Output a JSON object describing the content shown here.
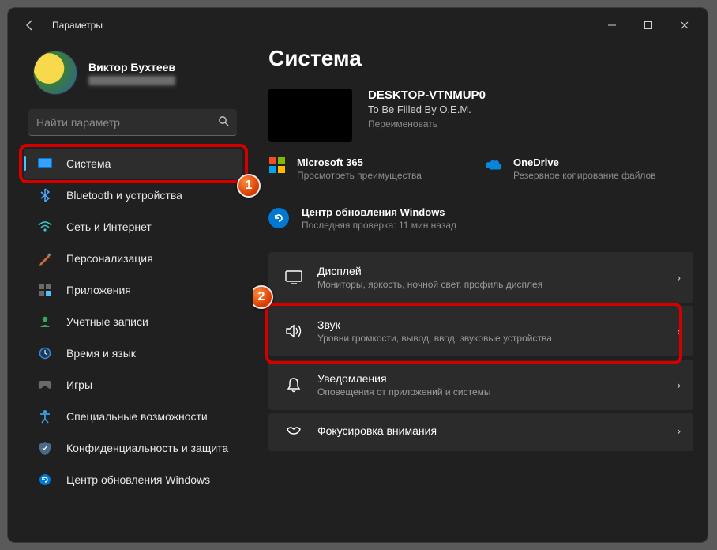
{
  "window": {
    "title": "Параметры"
  },
  "user": {
    "name": "Виктор Бухтеев"
  },
  "search": {
    "placeholder": "Найти параметр"
  },
  "sidebar": {
    "items": [
      {
        "label": "Система",
        "icon": "system"
      },
      {
        "label": "Bluetooth и устройства",
        "icon": "bluetooth"
      },
      {
        "label": "Сеть и Интернет",
        "icon": "network"
      },
      {
        "label": "Персонализация",
        "icon": "personalization"
      },
      {
        "label": "Приложения",
        "icon": "apps"
      },
      {
        "label": "Учетные записи",
        "icon": "accounts"
      },
      {
        "label": "Время и язык",
        "icon": "time"
      },
      {
        "label": "Игры",
        "icon": "gaming"
      },
      {
        "label": "Специальные возможности",
        "icon": "accessibility"
      },
      {
        "label": "Конфиденциальность и защита",
        "icon": "privacy"
      },
      {
        "label": "Центр обновления Windows",
        "icon": "update"
      }
    ]
  },
  "main": {
    "heading": "Система",
    "device": {
      "name": "DESKTOP-VTNMUP0",
      "sub": "To Be Filled By O.E.M.",
      "rename": "Переименовать"
    },
    "cloud": {
      "ms365": {
        "title": "Microsoft 365",
        "sub": "Просмотреть преимущества"
      },
      "onedrive": {
        "title": "OneDrive",
        "sub": "Резервное копирование файлов"
      }
    },
    "update": {
      "title": "Центр обновления Windows",
      "sub": "Последняя проверка: 11 мин назад"
    },
    "cards": [
      {
        "title": "Дисплей",
        "sub": "Мониторы, яркость, ночной свет, профиль дисплея"
      },
      {
        "title": "Звук",
        "sub": "Уровни громкости, вывод, ввод, звуковые устройства"
      },
      {
        "title": "Уведомления",
        "sub": "Оповещения от приложений и системы"
      },
      {
        "title": "Фокусировка внимания",
        "sub": ""
      }
    ]
  },
  "annotations": {
    "step1": "1",
    "step2": "2"
  }
}
